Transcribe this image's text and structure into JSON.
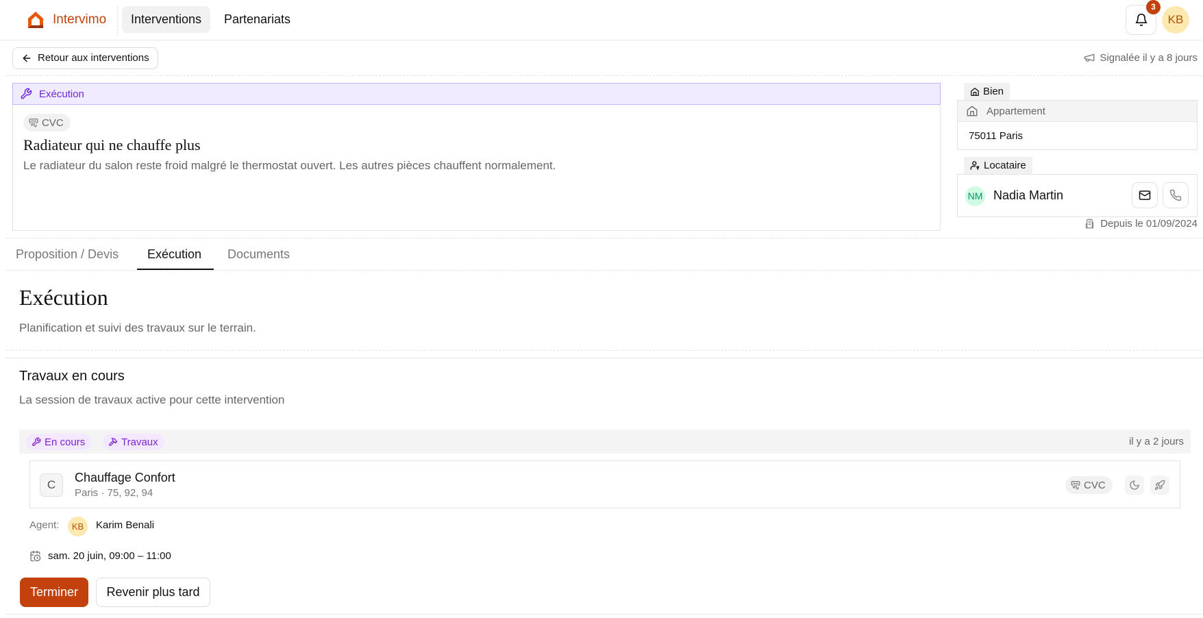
{
  "brand": {
    "name": "Intervimo"
  },
  "nav": {
    "tabs": [
      {
        "label": "Interventions",
        "active": true
      },
      {
        "label": "Partenariats",
        "active": false
      }
    ],
    "notifications_count": "3",
    "user_initials": "KB"
  },
  "back": {
    "label": "Retour aux interventions"
  },
  "reported": {
    "text": "Signalée il y a 8 jours"
  },
  "intervention": {
    "phase": "Exécution",
    "category": "CVC",
    "title": "Radiateur qui ne chauffe plus",
    "description": "Le radiateur du salon reste froid malgré le thermostat ouvert. Les autres pièces chauffent normalement."
  },
  "property": {
    "label": "Bien",
    "type": "Appartement",
    "address": "75011 Paris"
  },
  "tenant": {
    "label": "Locataire",
    "initials": "NM",
    "name": "Nadia Martin",
    "since": "Depuis le 01/09/2024"
  },
  "tabs": [
    {
      "label": "Proposition / Devis",
      "active": false
    },
    {
      "label": "Exécution",
      "active": true
    },
    {
      "label": "Documents",
      "active": false
    }
  ],
  "section": {
    "title": "Exécution",
    "subtitle": "Planification et suivi des travaux sur le terrain."
  },
  "works": {
    "title": "Travaux en cours",
    "subtitle": "La session de travaux active pour cette intervention",
    "status_pill": "En cours",
    "type_pill": "Travaux",
    "time": "il y a 2 jours",
    "company": {
      "initial": "C",
      "name": "Chauffage Confort",
      "location": "Paris · 75, 92, 94",
      "category": "CVC"
    },
    "agent_label": "Agent:",
    "agent_initials": "KB",
    "agent_name": "Karim Benali",
    "schedule": "sam. 20 juin, 09:00 – 11:00",
    "finish_label": "Terminer",
    "later_label": "Revenir plus tard"
  },
  "colors": {
    "accent": "#c2410c",
    "phase_bg": "#f0ebff",
    "phase_text": "#6d28d9",
    "pill_bg": "#f3e8ff",
    "pill_text": "#7e22ce"
  }
}
